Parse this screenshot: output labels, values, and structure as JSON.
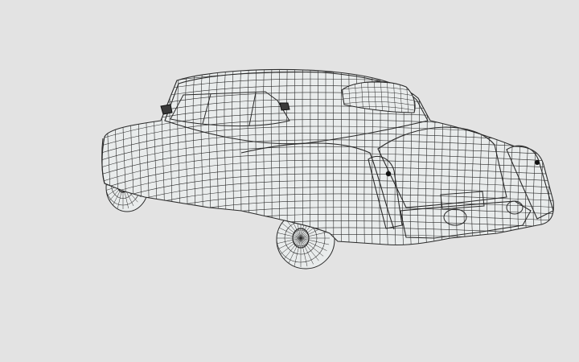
{
  "viewport": {
    "background_color": "#e3e3e3",
    "wire_color": "#2a2a2a",
    "surface_color": "#e9ecec",
    "lamp_color": "#111111"
  }
}
